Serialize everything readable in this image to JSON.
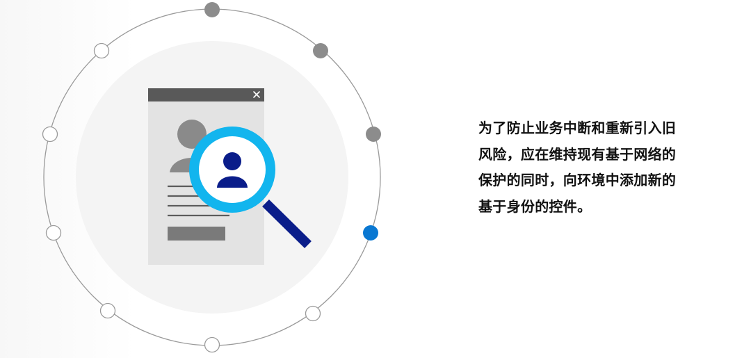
{
  "caption": {
    "lines": [
      "为了防止业务中断和重新引入旧",
      "风险，应在维持现有基于网络的",
      "保护的同时，向环境中添加新的",
      "基于身份的控件。"
    ]
  },
  "illustration": {
    "icons": [
      "profile-card-icon",
      "close-icon",
      "magnifier-icon",
      "user-icon"
    ],
    "colors": {
      "ring": "#9a9a9a",
      "inner_disc": "#f4f4f4",
      "node_gray": "#8c8c8c",
      "node_blue": "#0a78d2",
      "card_bg": "#e3e3e3",
      "card_header": "#595959",
      "avatar": "#8a8a8a",
      "lens_ring": "#12b5ee",
      "handle": "#0a1d8a",
      "user_glyph": "#0a1d8a"
    }
  }
}
